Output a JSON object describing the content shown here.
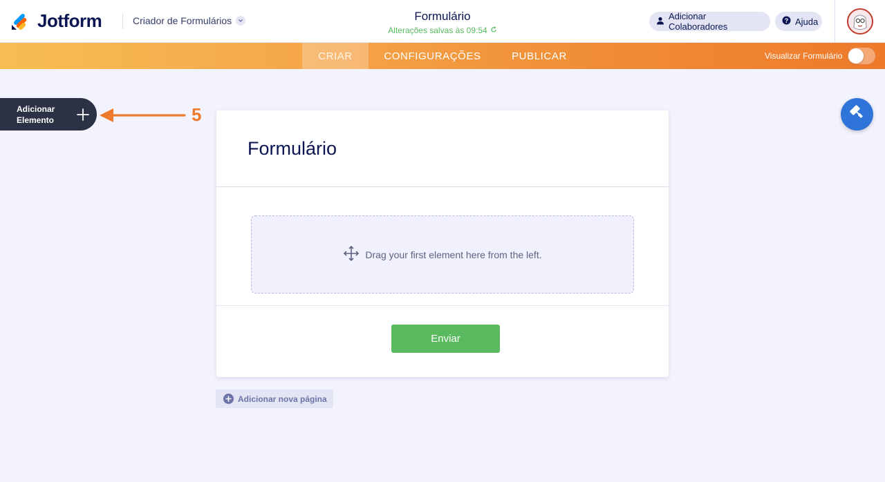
{
  "header": {
    "brand": "Jotform",
    "builder_name": "Criador de Formulários",
    "form_title": "Formulário",
    "saved_status": "Alterações salvas às 09:54",
    "collaborators_label": "Adicionar Colaboradores",
    "help_label": "Ajuda"
  },
  "nav": {
    "tabs": [
      {
        "label": "CRIAR",
        "active": true
      },
      {
        "label": "CONFIGURAÇÕES",
        "active": false
      },
      {
        "label": "PUBLICAR",
        "active": false
      }
    ],
    "preview_label": "Visualizar Formulário",
    "preview_enabled": false
  },
  "sidebar": {
    "add_element_label": "Adicionar Elemento"
  },
  "annotation": {
    "step_number": "5"
  },
  "form": {
    "heading": "Formulário",
    "drop_hint": "Drag your first element here from the left.",
    "submit_label": "Enviar",
    "add_page_label": "Adicionar nova página"
  },
  "colors": {
    "accent_orange": "#ee7a2c",
    "submit_green": "#5bb95f",
    "designer_blue": "#2f74d8",
    "dark_navy": "#0a1551"
  },
  "icons": {
    "logo": "jotform-logo-icon",
    "chevron": "chevron-down-icon",
    "user": "user-icon",
    "help": "question-circle-icon",
    "plus": "plus-icon",
    "move": "move-arrows-icon",
    "designer": "paint-roller-icon"
  }
}
